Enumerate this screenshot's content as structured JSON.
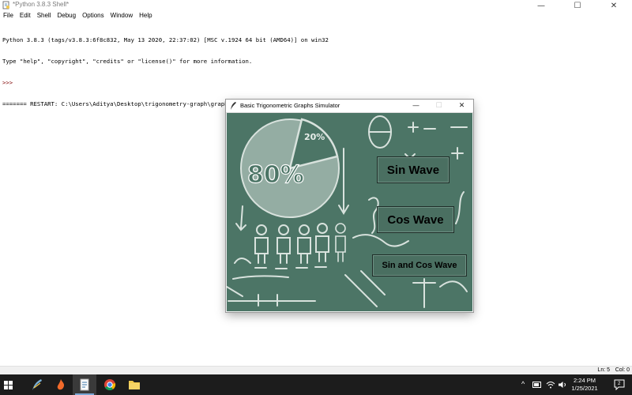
{
  "idle": {
    "title": "*Python 3.8.3 Shell*",
    "menu": [
      "File",
      "Edit",
      "Shell",
      "Debug",
      "Options",
      "Window",
      "Help"
    ],
    "window_controls": {
      "minimize": "—",
      "maximize": "☐",
      "close": "✕"
    },
    "shell_lines": [
      "Python 3.8.3 (tags/v3.8.3:6f8c832, May 13 2020, 22:37:02) [MSC v.1924 64 bit (AMD64)] on win32",
      "Type \"help\", \"copyright\", \"credits\" or \"license()\" for more information.",
      ">>> ",
      "======= RESTART: C:\\Users\\Aditya\\Desktop\\trigonometry-graph\\graph_plot.py ======"
    ],
    "status": {
      "ln": "Ln: 5",
      "col": "Col: 0"
    }
  },
  "app": {
    "title": "Basic Trigonometric Graphs Simulator",
    "controls": {
      "minimize": "—",
      "maximize": "☐",
      "close": "✕"
    },
    "buttons": {
      "sin": "Sin Wave",
      "cos": "Cos Wave",
      "sin_cos": "Sin and Cos Wave"
    },
    "chalk_text": {
      "big_percent": "80%",
      "small_percent": "20%"
    },
    "colors": {
      "board": "#4c7566",
      "button": "#4a6f61",
      "chalk": "#eef2ef"
    }
  },
  "taskbar": {
    "apps": [
      "windows-logo",
      "python-idle",
      "fire-app",
      "file-explorer",
      "chrome",
      "folder"
    ],
    "tray": {
      "chevron": "^",
      "battery": "🔋",
      "wifi": "wifi",
      "volume": "🔊"
    },
    "time": "2:24 PM",
    "date": "1/25/2021",
    "notification_count": "2"
  }
}
